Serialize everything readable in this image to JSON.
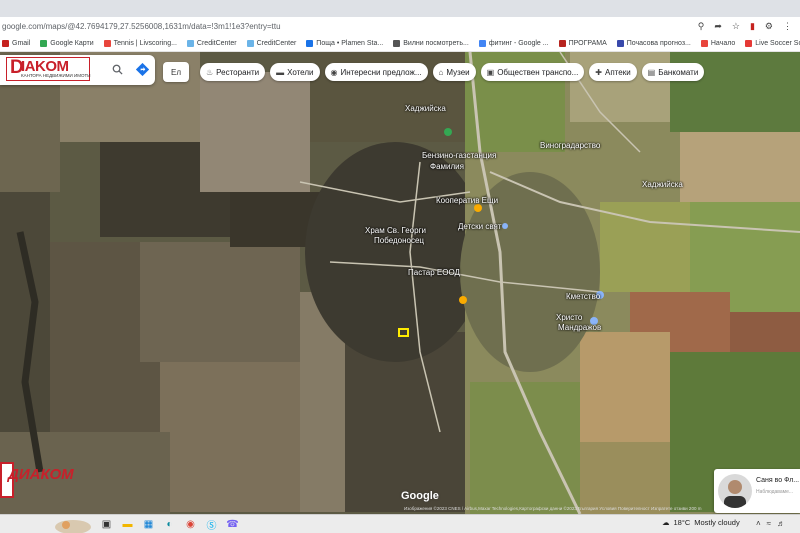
{
  "browser": {
    "url": "google.com/maps/@42.7694179,27.5256008,1631m/data=!3m1!1e3?entry=ttu",
    "toolbar_icons": [
      "location-icon",
      "share-icon",
      "star-icon",
      "pdf-icon",
      "extension-icon",
      "menu-icon"
    ]
  },
  "bookmarks": [
    {
      "label": "Gmail",
      "color": "#c5221f"
    },
    {
      "label": "Google Карти",
      "color": "#34a853"
    },
    {
      "label": "Tennis | Livscoring...",
      "color": "#e8453c"
    },
    {
      "label": "CreditCenter",
      "color": "#6bb4e8"
    },
    {
      "label": "CreditCenter",
      "color": "#6bb4e8"
    },
    {
      "label": "Поща • Plamen Sta...",
      "color": "#1a73e8"
    },
    {
      "label": "Вилни посмотреть...",
      "color": "#555555"
    },
    {
      "label": "фитинг - Google ...",
      "color": "#4285f4"
    },
    {
      "label": "ПРОГРАМА",
      "color": "#b7241f"
    },
    {
      "label": "Почасова прогноз...",
      "color": "#3949ab"
    },
    {
      "label": "Начало",
      "color": "#e8453c"
    },
    {
      "label": "Live Soccer Scores...",
      "color": "#e53935"
    }
  ],
  "search": {
    "logo_letter": "D",
    "logo_text": "IAKOM",
    "logo_subtitle": "КАНТОРА НЕДВИЖИМИ ИМОТИ"
  },
  "language_button": {
    "label": "Ел"
  },
  "chips": [
    {
      "label": "Ресторанти",
      "icon": "fork-knife-icon"
    },
    {
      "label": "Хотели",
      "icon": "bed-icon"
    },
    {
      "label": "Интересни предлож...",
      "icon": "camera-icon"
    },
    {
      "label": "Музеи",
      "icon": "museum-icon"
    },
    {
      "label": "Обществен транспо...",
      "icon": "bus-icon"
    },
    {
      "label": "Аптеки",
      "icon": "pharmacy-icon"
    },
    {
      "label": "Банкомати",
      "icon": "atm-icon"
    }
  ],
  "map_labels": [
    {
      "text": "Хаджийска",
      "cls": "road"
    },
    {
      "text": "Бензино-газстанция",
      "cls": "poi"
    },
    {
      "text": "Фамилия",
      "cls": "poi"
    },
    {
      "text": "Кооператив Ещи",
      "cls": "poi"
    },
    {
      "text": "Детски свят",
      "cls": "poi"
    },
    {
      "text": "Храм Св. Георги",
      "cls": "poi"
    },
    {
      "text": "Победоносец",
      "cls": "poi"
    },
    {
      "text": "Пастар ЕООД",
      "cls": "poi"
    },
    {
      "text": "Кметство",
      "cls": "poi"
    },
    {
      "text": "Христо",
      "cls": "poi"
    },
    {
      "text": "Мандражов",
      "cls": "poi"
    },
    {
      "text": "Хаджийска",
      "cls": "road"
    },
    {
      "text": "Виноградарство",
      "cls": "poi"
    }
  ],
  "map_footer": {
    "google": "Google",
    "attribution": "Изображения ©2023 CNES / Airbus,Maxar Technologies,Картографски данни ©2023   България   Условия   Поверителност   Изпратете отзиви   200 m"
  },
  "watermark": {
    "text": "ДИАКОМ"
  },
  "chat": {
    "name": "Саня во Фл...",
    "status": "Наблюдаваме..."
  },
  "taskbar": {
    "apps": [
      "task-view-icon",
      "file-explorer-icon",
      "store-icon",
      "edge-icon",
      "chrome-icon",
      "skype-icon",
      "viber-icon"
    ],
    "temperature": "18°C",
    "weather": "Mostly cloudy"
  },
  "colors": {
    "field_dark": "#4a4436",
    "field_brown": "#7a6e58",
    "field_green": "#5e7a3a",
    "road": "#c9c4b2",
    "accent_red": "#c8202a",
    "marker": "#ffeb00"
  }
}
